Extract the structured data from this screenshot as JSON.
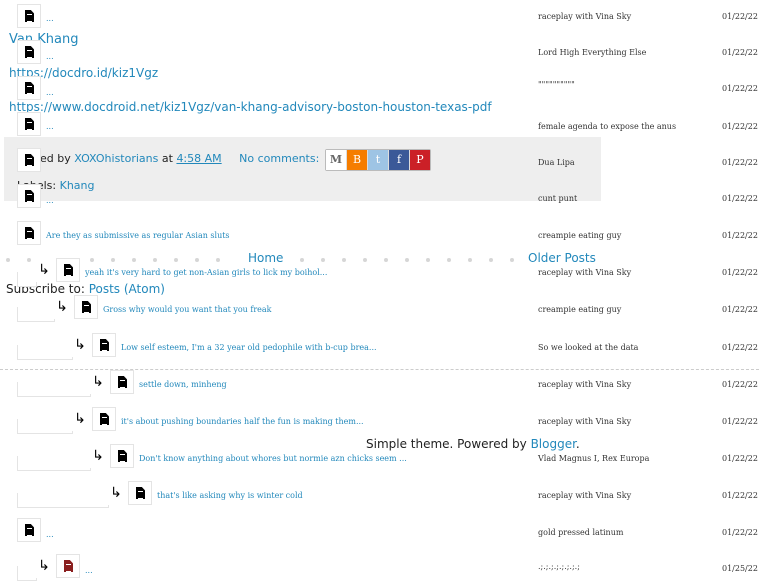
{
  "post": {
    "title": "Van Khang",
    "link1": "https://docdro.id/kiz1Vgz",
    "link2": "https://www.docdroid.net/kiz1Vgz/van-khang-advisory-boston-houston-texas-pdf",
    "posted_prefix": "Posted by",
    "author": "XOXOhistorians",
    "at": "at",
    "time": "4:58 AM",
    "comments": "No comments:",
    "labels_prefix": "Labels:",
    "label": "Khang",
    "share_icons": [
      "email-icon",
      "blogger-icon",
      "twitter-icon",
      "facebook-icon",
      "pinterest-icon"
    ]
  },
  "nav": {
    "home": "Home",
    "older": "Older Posts"
  },
  "subscribe": {
    "prefix": "Subscribe to:",
    "link": "Posts (Atom)"
  },
  "footer": {
    "prefix": "Simple theme. Powered by",
    "link": "Blogger",
    "suffix": "."
  },
  "comments": [
    {
      "title": "...",
      "author": "raceplay with Vina Sky",
      "date": "01/22/22"
    },
    {
      "title": "...",
      "author": "Lord High Everything Else",
      "date": "01/22/22"
    },
    {
      "title": "...",
      "author": "\"\"\"\"\"\"\"\"\"\"",
      "date": "01/22/22"
    },
    {
      "title": "...",
      "author": "female agenda to expose the anus",
      "date": "01/22/22"
    },
    {
      "title": "",
      "author": "Dua Lipa",
      "date": "01/22/22"
    },
    {
      "title": "...",
      "author": "cunt punt",
      "date": "01/22/22"
    },
    {
      "title": "Are they as submissive as regular Asian sluts",
      "author": "creampie eating guy",
      "date": "01/22/22"
    },
    {
      "title": "yeah it's very hard to get non-Asian girls to lick my boihol...",
      "author": "raceplay with Vina Sky",
      "date": "01/22/22"
    },
    {
      "title": "Gross why would you want that you freak",
      "author": "creampie eating guy",
      "date": "01/22/22"
    },
    {
      "title": "Low self esteem, I'm a 32 year old pedophile with b-cup brea...",
      "author": "So we looked at the data",
      "date": "01/22/22"
    },
    {
      "title": "settle down, minheng",
      "author": "raceplay with Vina Sky",
      "date": "01/22/22"
    },
    {
      "title": "it's about pushing boundaries half the fun is making them...",
      "author": "raceplay with Vina Sky",
      "date": "01/22/22"
    },
    {
      "title": "Don't know anything about whores but normie azn chicks seem ...",
      "author": "Vlad Magnus I, Rex Europa",
      "date": "01/22/22"
    },
    {
      "title": "that's like asking why is winter cold",
      "author": "raceplay with Vina Sky",
      "date": "01/22/22"
    },
    {
      "title": "...",
      "author": "gold pressed latinum",
      "date": "01/22/22"
    },
    {
      "title": "...",
      "author": ".;.;.;.;.;.;.;.;",
      "date": "01/25/22"
    }
  ],
  "colors": {
    "link": "#2288bb",
    "footer_bg": "#eeeeee"
  }
}
